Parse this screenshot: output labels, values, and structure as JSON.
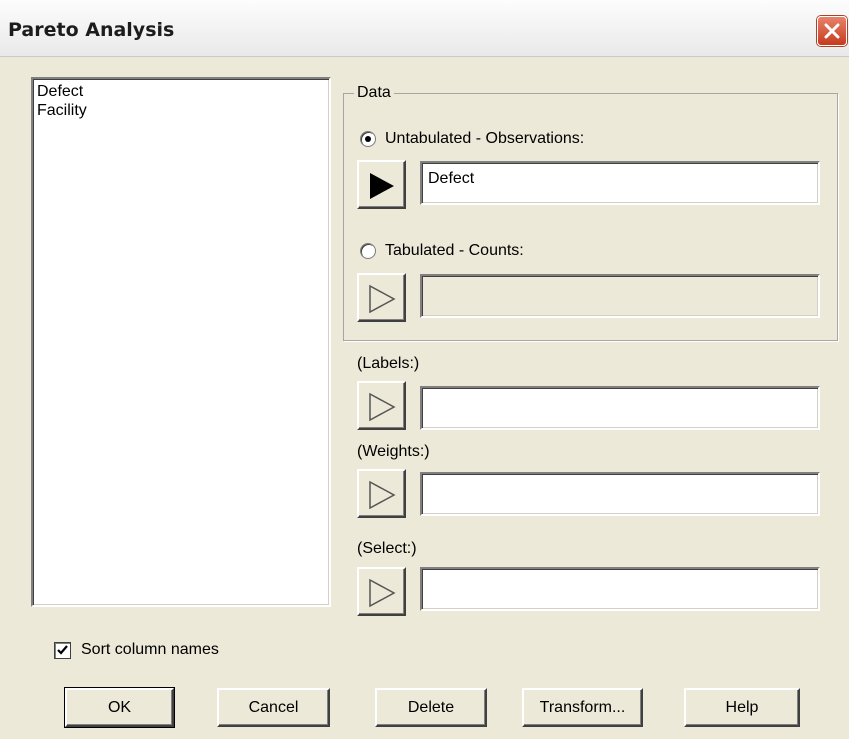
{
  "window": {
    "title": "Pareto Analysis",
    "close_icon": "close-icon",
    "close_color": "#c63a1c"
  },
  "column_list": {
    "items": [
      "Defect",
      "Facility"
    ]
  },
  "data_group": {
    "label": "Data",
    "untabulated": {
      "label": "Untabulated - Observations:",
      "selected": true,
      "value": "Defect"
    },
    "tabulated": {
      "label": "Tabulated - Counts:",
      "selected": false,
      "value": ""
    }
  },
  "labels_field": {
    "label": "(Labels:)",
    "value": ""
  },
  "weights_field": {
    "label": "(Weights:)",
    "value": ""
  },
  "select_field": {
    "label": "(Select:)",
    "value": ""
  },
  "sort_option": {
    "label": "Sort column names",
    "checked": true
  },
  "buttons": {
    "ok": "OK",
    "cancel": "Cancel",
    "delete": "Delete",
    "transform": "Transform...",
    "help": "Help"
  }
}
